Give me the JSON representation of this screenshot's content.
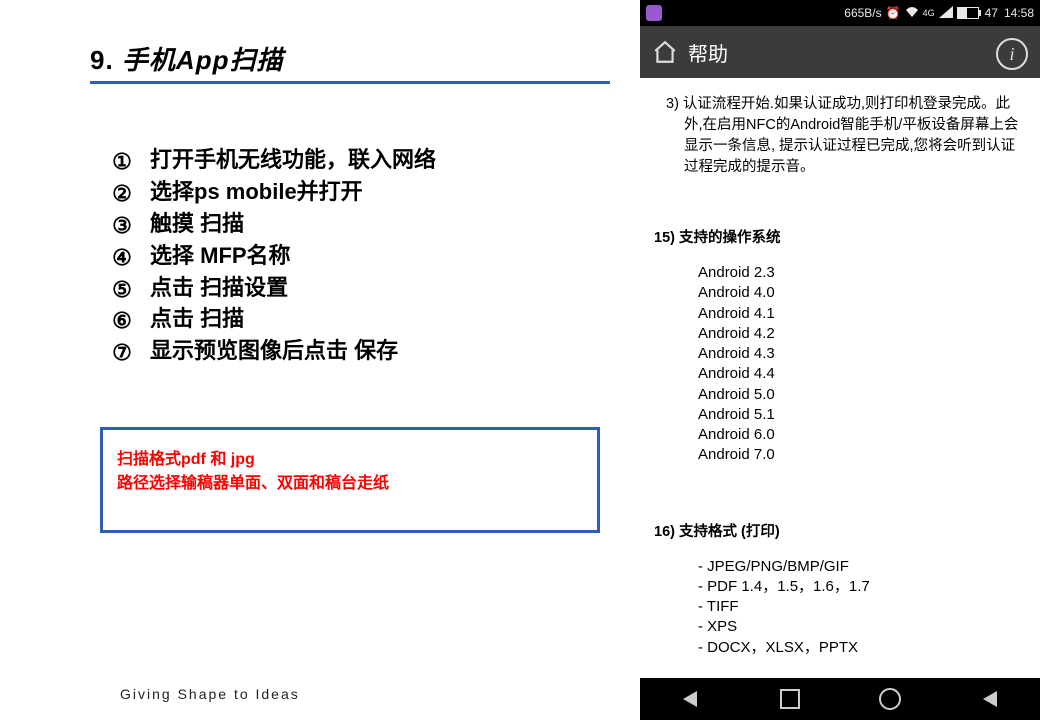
{
  "doc": {
    "title_number": "9.",
    "title_text": "手机App扫描",
    "steps": [
      "打开手机无线功能，联入网络",
      "选择ps mobile并打开",
      "触摸   扫描",
      "选择   MFP名称",
      "点击   扫描设置",
      "点击   扫描",
      "显示预览图像后点击 保存"
    ],
    "step_markers": [
      "①",
      "②",
      "③",
      "④",
      "⑤",
      "⑥",
      "⑦"
    ],
    "note": {
      "line1": "扫描格式pdf 和 jpg",
      "line2": "路径选择输稿器单面、双面和稿台走纸"
    },
    "footer": "Giving Shape to Ideas"
  },
  "phone": {
    "status": {
      "net_speed": "665B/s",
      "signal_label": "4G",
      "battery_pct": "47",
      "time": "14:58"
    },
    "appbar_title": "帮助",
    "para3": "3) 认证流程开始.如果认证成功,则打印机登录完成。此外,在启用NFC的Android智能手机/平板设备屏幕上会显示一条信息, 提示认证过程已完成,您将会听到认证过程完成的提示音。",
    "section15": {
      "heading": "15) 支持的操作系统",
      "items": [
        "Android 2.3",
        "Android 4.0",
        "Android 4.1",
        "Android 4.2",
        "Android 4.3",
        "Android 4.4",
        "Android 5.0",
        "Android 5.1",
        "Android 6.0",
        "Android 7.0"
      ]
    },
    "section16": {
      "heading": "16) 支持格式 (打印)",
      "items": [
        "JPEG/PNG/BMP/GIF",
        "PDF 1.4，1.5，1.6，1.7",
        "TIFF",
        "XPS",
        "DOCX，XLSX，PPTX"
      ]
    }
  }
}
